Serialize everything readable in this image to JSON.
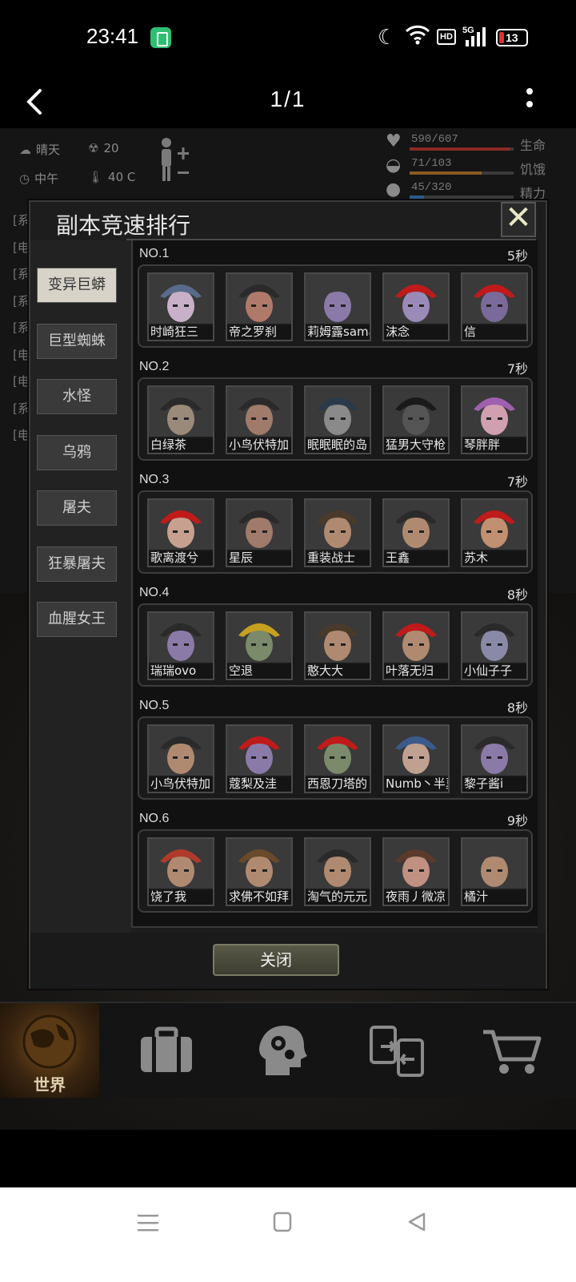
{
  "status_bar": {
    "time": "23:41",
    "network_badge": "HD",
    "network_type": "5G",
    "battery_level": "13"
  },
  "header": {
    "pager": "1/1"
  },
  "hud": {
    "weather": "晴天",
    "radiation": "20",
    "time_of_day": "中午",
    "temperature": "40 C",
    "stats": [
      {
        "value": "590/607",
        "label": "生命",
        "fraction": 0.97,
        "color": "#8a2a22"
      },
      {
        "value": "71/103",
        "label": "饥饿",
        "fraction": 0.69,
        "color": "#8a5a22"
      },
      {
        "value": "45/320",
        "label": "精力",
        "fraction": 0.14,
        "color": "#2a5a8a"
      }
    ],
    "log_lines": [
      "[系",
      "[电",
      "[系",
      "[系",
      "[系",
      "[电",
      "[电",
      "[系",
      "[电"
    ]
  },
  "modal": {
    "title": "副本竞速排行",
    "close_icon": "close-x-icon",
    "close_button_label": "关闭",
    "tabs": [
      {
        "label": "变异巨蟒",
        "active": true
      },
      {
        "label": "巨型蜘蛛",
        "active": false
      },
      {
        "label": "水怪",
        "active": false
      },
      {
        "label": "乌鸦",
        "active": false
      },
      {
        "label": "屠夫",
        "active": false
      },
      {
        "label": "狂暴屠夫",
        "active": false
      },
      {
        "label": "血腥女王",
        "active": false
      }
    ],
    "rankings": [
      {
        "rank": "NO.1",
        "time": "5秒",
        "players": [
          "时崎狂三",
          "帝之罗刹",
          "莉姆露sama",
          "沫念",
          "信"
        ]
      },
      {
        "rank": "NO.2",
        "time": "7秒",
        "players": [
          "白绿茶",
          "小鸟伏特加",
          "眠眠眠的岛",
          "猛男大守枪",
          "琴胖胖"
        ]
      },
      {
        "rank": "NO.3",
        "time": "7秒",
        "players": [
          "歌离渡兮",
          "星辰",
          "重装战士",
          "王鑫",
          "苏木"
        ]
      },
      {
        "rank": "NO.4",
        "time": "8秒",
        "players": [
          "瑞瑞ovo",
          "空退",
          "憨大大",
          "叶落无归",
          "小仙子子"
        ]
      },
      {
        "rank": "NO.5",
        "time": "8秒",
        "players": [
          "小鸟伏特加",
          "蔻梨及洼",
          "西恩刀塔的",
          "Numb丶半夏",
          "黎子酱i"
        ]
      },
      {
        "rank": "NO.6",
        "time": "9秒",
        "players": [
          "饶了我",
          "求佛不如拜",
          "淘气的元元",
          "夜雨丿微凉",
          "橘汁"
        ]
      }
    ]
  },
  "game_nav": [
    {
      "label": "世界",
      "icon": "globe-icon",
      "active": true
    },
    {
      "label": "",
      "icon": "briefcase-icon",
      "active": false
    },
    {
      "label": "",
      "icon": "head-gear-icon",
      "active": false
    },
    {
      "label": "",
      "icon": "transfer-icon",
      "active": false
    },
    {
      "label": "",
      "icon": "cart-icon",
      "active": false
    }
  ],
  "android_nav": [
    "menu-icon",
    "home-icon",
    "back-triangle-icon"
  ]
}
